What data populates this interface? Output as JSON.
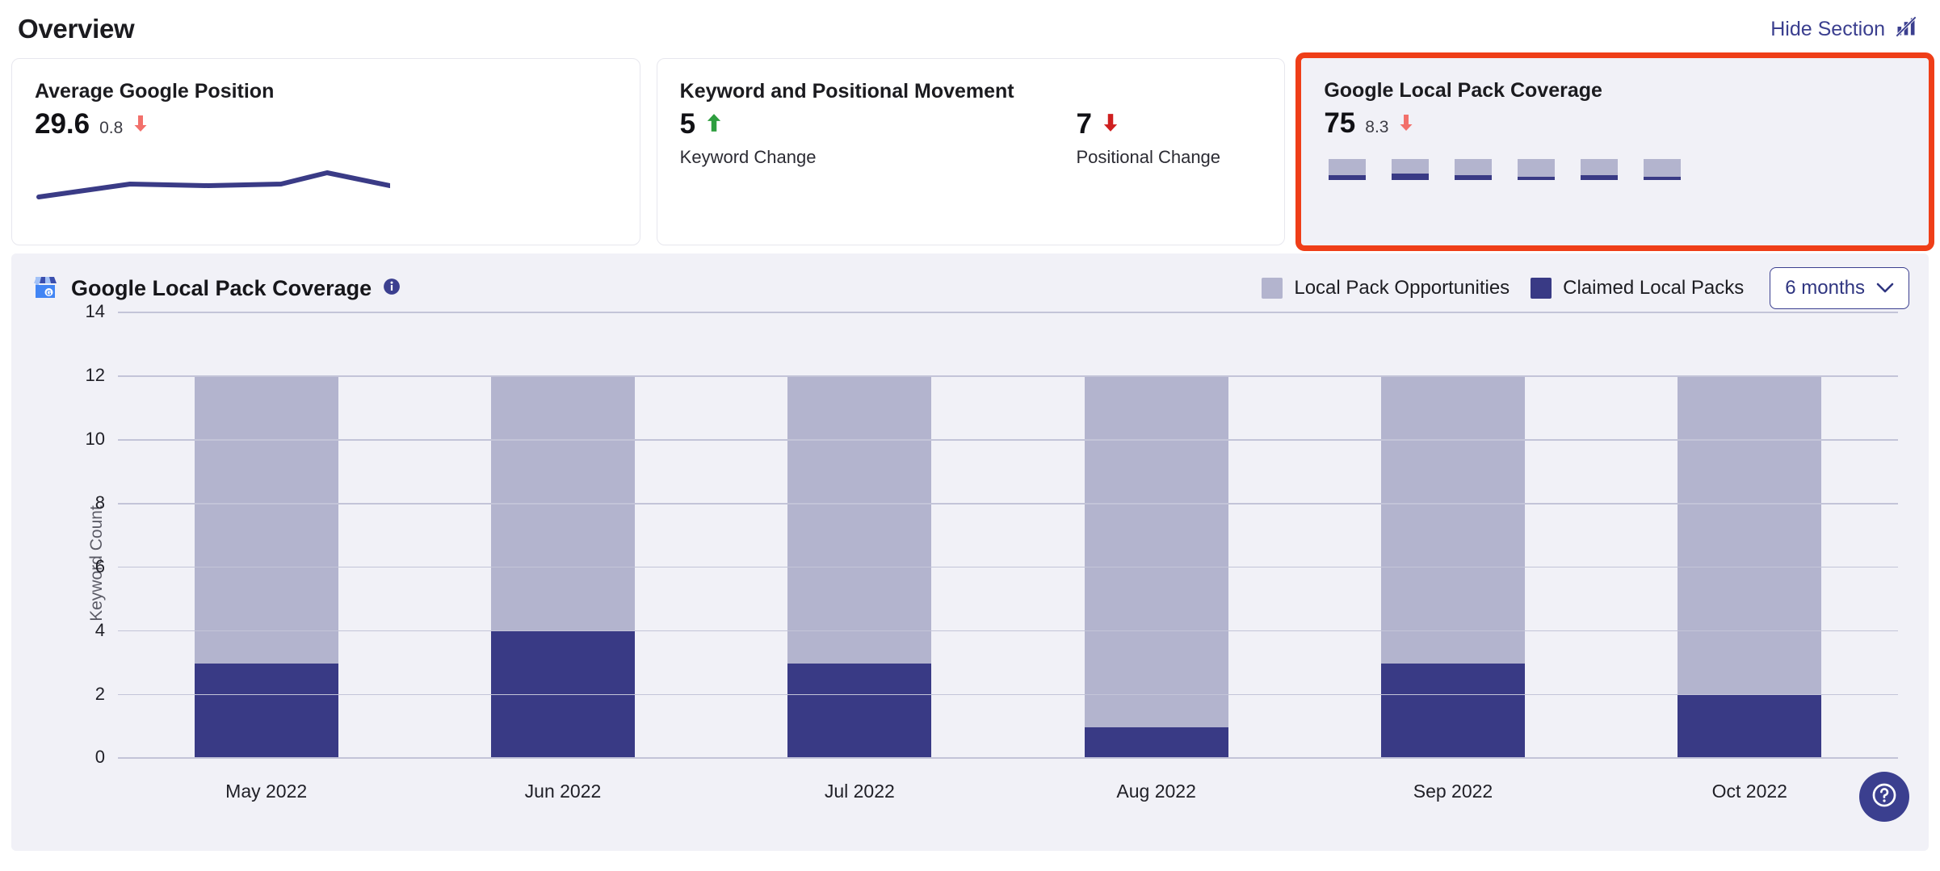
{
  "header": {
    "title": "Overview",
    "hide_section_label": "Hide Section",
    "hide_section_icon": "bar-chart-slash-icon",
    "link_color": "#3b3f8f"
  },
  "kpi_cards": [
    {
      "title": "Average Google Position",
      "value": "29.6",
      "delta": "0.8",
      "trend": "down",
      "trend_color": "#f2706b",
      "visual": "sparkline"
    },
    {
      "title": "Keyword and Positional Movement",
      "metrics": [
        {
          "value": "5",
          "trend": "up",
          "trend_color": "#2e9e3f",
          "label": "Keyword Change"
        },
        {
          "value": "7",
          "trend": "down",
          "trend_color": "#cf1f1f",
          "label": "Positional Change"
        }
      ]
    },
    {
      "title": "Google Local Pack Coverage",
      "value": "75",
      "delta": "8.3",
      "trend": "down",
      "trend_color": "#f2706b",
      "visual": "mini-bars",
      "highlighted": true,
      "highlight_color": "#ef3e18",
      "mini_bars": [
        {
          "total": 12,
          "claimed": 3
        },
        {
          "total": 12,
          "claimed": 4
        },
        {
          "total": 12,
          "claimed": 3
        },
        {
          "total": 12,
          "claimed": 1
        },
        {
          "total": 12,
          "claimed": 3
        },
        {
          "total": 12,
          "claimed": 2
        }
      ]
    }
  ],
  "chart_panel": {
    "title": "Google Local Pack Coverage",
    "title_icon": "google-business-profile-icon",
    "info_icon": "info-icon",
    "range_selected": "6 months",
    "range_chevron_icon": "chevron-down-icon",
    "help_button_icon": "question-mark-icon"
  },
  "chart_data": {
    "type": "bar",
    "stacked": true,
    "title": "Google Local Pack Coverage",
    "xlabel": "",
    "ylabel": "Keyword Count",
    "categories": [
      "May 2022",
      "Jun 2022",
      "Jul 2022",
      "Aug 2022",
      "Sep 2022",
      "Oct 2022"
    ],
    "yticks": [
      0,
      2,
      4,
      6,
      8,
      10,
      12,
      14
    ],
    "ylim": [
      0,
      14
    ],
    "grid": true,
    "legend_position": "top-right",
    "series": [
      {
        "name": "Claimed Local Packs",
        "color": "#393a85",
        "values": [
          3,
          4,
          3,
          1,
          3,
          2
        ]
      },
      {
        "name": "Local Pack Opportunities",
        "color": "#b3b4ce",
        "values": [
          9,
          8,
          9,
          11,
          9,
          10
        ]
      }
    ],
    "stack_totals": [
      12,
      12,
      12,
      12,
      12,
      12
    ]
  }
}
